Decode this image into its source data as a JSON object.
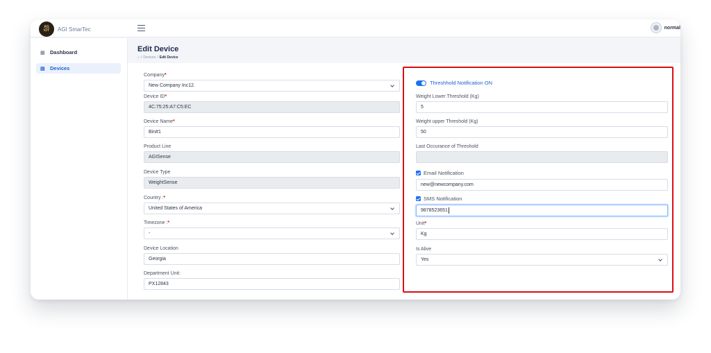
{
  "app": {
    "brand_name": "AGI SmarTec",
    "logo_top": "AG",
    "logo_bottom": "iOT",
    "user_name": "normal"
  },
  "sidebar": {
    "items": [
      {
        "label": "Dashboard",
        "icon": "grid-icon"
      },
      {
        "label": "Devices",
        "icon": "server-icon"
      }
    ]
  },
  "header": {
    "title": "Edit Device",
    "breadcrumb": [
      "Devices",
      "Edit Device"
    ]
  },
  "left_form": {
    "company": {
      "label": "Company",
      "value": "New Company Inc12."
    },
    "device_id": {
      "label": "Device ID",
      "value": "4C:75:25:A7:C5:EC"
    },
    "device_name": {
      "label": "Device Name",
      "value": "Bin#1"
    },
    "product_line": {
      "label": "Product Line",
      "value": "AGISense"
    },
    "device_type": {
      "label": "Device Type",
      "value": "WeightSense"
    },
    "country": {
      "label": "Country :",
      "value": "United States of America"
    },
    "timezone": {
      "label": "Timezone :",
      "value": "-"
    },
    "device_location": {
      "label": "Device Location",
      "value": "Georgia"
    },
    "department_unit": {
      "label": "Department Unit:",
      "value": "PX12843"
    }
  },
  "right_form": {
    "threshold_toggle": {
      "label": "Threshhold Notification ON",
      "on": true
    },
    "weight_lower": {
      "label": "Weight Lower Threshold (Kg)",
      "value": "5"
    },
    "weight_upper": {
      "label": "Weight upper Threshold (Kg)",
      "value": "50"
    },
    "last_occurance": {
      "label": "Last Occurance of Threshold",
      "value": ""
    },
    "email_notification": {
      "label": "Email Notification",
      "checked": true,
      "value": "new@newcompany.com"
    },
    "sms_notification": {
      "label": "SMS Notification",
      "checked": true,
      "value": "9878523651"
    },
    "unit": {
      "label": "Unit",
      "value": "Kg"
    },
    "is_alive": {
      "label": "Is Alive",
      "value": "Yes"
    }
  },
  "colors": {
    "accent": "#1f6ff0",
    "highlight_border": "#d90f14",
    "required": "#d61f1f"
  }
}
